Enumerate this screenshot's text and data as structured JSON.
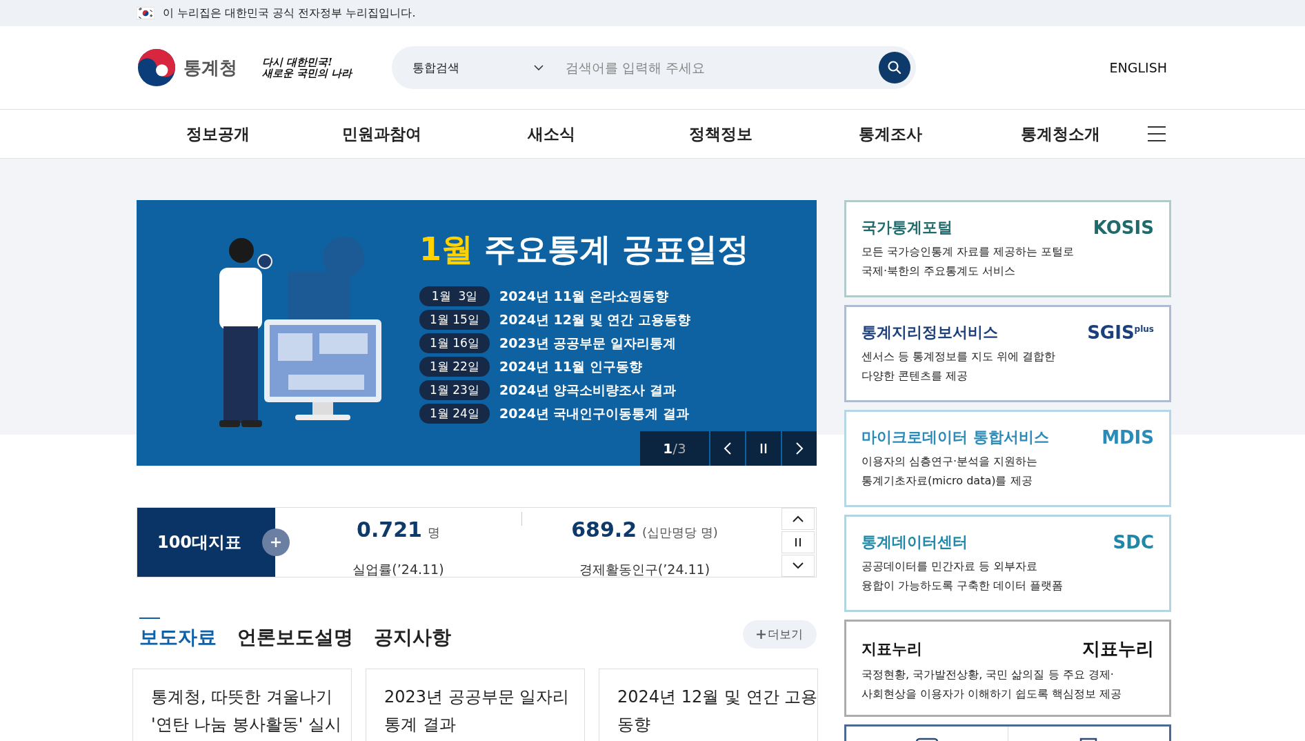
{
  "gov_banner": {
    "text": "이 누리집은 대한민국 공식 전자정부 누리집입니다."
  },
  "header": {
    "agency": "통계청",
    "slogan": [
      "다시 대한민국!",
      "새로운 국민의 나라"
    ],
    "search": {
      "scope": "통합검색",
      "placeholder": "검색어를 입력해 주세요"
    },
    "language": "ENGLISH"
  },
  "nav": [
    "정보공개",
    "민원과참여",
    "새소식",
    "정책정보",
    "통계조사",
    "통계청소개"
  ],
  "hero": {
    "title_highlight": "1월",
    "title": "주요통계 공표일정",
    "schedule": [
      {
        "date": "1월  3일",
        "title": "2024년 11월 온라쇼핑동향"
      },
      {
        "date": "1월 15일",
        "title": "2024년 12월 및 연간 고용동향"
      },
      {
        "date": "1월 16일",
        "title": "2023년 공공부문 일자리통계"
      },
      {
        "date": "1월 22일",
        "title": "2024년 11월 인구동향"
      },
      {
        "date": "1월 23일",
        "title": "2024년 양곡소비량조사 결과"
      },
      {
        "date": "1월 24일",
        "title": "2024년 국내인구이동통계 결과"
      }
    ],
    "pager": {
      "current": "1",
      "total": "/3"
    }
  },
  "indicators": {
    "label": "100대지표",
    "items": [
      {
        "value": "0.721",
        "unit": "명",
        "next_label": "실업률(’24.11)"
      },
      {
        "value": "689.2",
        "unit": "(십만명당 명)",
        "next_label": "경제활동인구(’24.11)"
      }
    ]
  },
  "news": {
    "tabs": [
      {
        "label": "보도자료",
        "selected": true
      },
      {
        "label": "언론보도설명",
        "selected": false
      },
      {
        "label": "공지사항",
        "selected": false
      }
    ],
    "more": "더보기",
    "cards": [
      {
        "lines": [
          "통계청, 따뜻한 겨울나기",
          "'연탄 나눔 봉사활동' 실시"
        ]
      },
      {
        "lines": [
          "2023년 공공부문 일자리",
          "통계 결과"
        ]
      },
      {
        "lines": [
          "2024년 12월 및 연간 고용",
          "동향"
        ]
      }
    ]
  },
  "services": [
    {
      "title": "국가통계포털",
      "logo": "KOSIS",
      "color": "#1f6b6b",
      "lines": [
        "모든 국가승인통계 자료를 제공하는 포털로",
        "국제·북한의 주요통계도 서비스"
      ]
    },
    {
      "title": "통계지리정보서비스",
      "logo": "SGIS",
      "logo_sup": "plus",
      "color": "#1b3f7a",
      "lines": [
        "센서스 등 통계정보를 지도 위에 결합한",
        "다양한 콘텐츠를 제공"
      ]
    },
    {
      "title": "마이크로데이터 통합서비스",
      "logo": "MDIS",
      "color": "#2b8bb8",
      "lines": [
        "이용자의 심층연구·분석을 지원하는",
        "통계기초자료(micro data)를 제공"
      ]
    },
    {
      "title": "통계데이터센터",
      "logo": "SDC",
      "color": "#1f88a8",
      "lines": [
        "공공데이터를 민간자료 등 외부자료",
        "융합이 가능하도록 구축한 데이터 플랫폼"
      ]
    },
    {
      "title": "지표누리",
      "logo": "지표누리",
      "color": "#111111",
      "lines": [
        "국정현황, 국가발전상황, 국민 삶의질 등 주요 경제·",
        "사회현상을 이용자가 이해하기 쉽도록 핵심정보 제공"
      ]
    }
  ]
}
